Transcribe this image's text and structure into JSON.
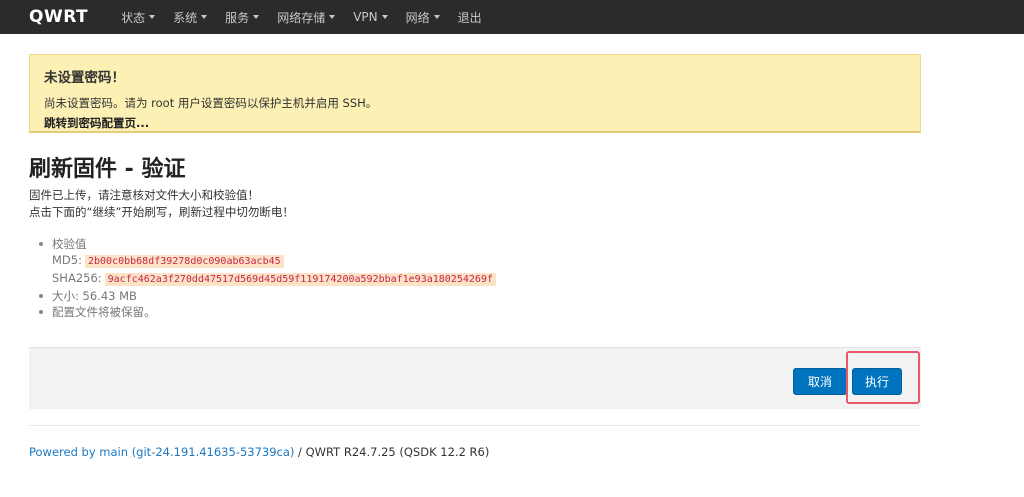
{
  "navbar": {
    "brand": "QWRT",
    "items": [
      {
        "label": "状态"
      },
      {
        "label": "系统"
      },
      {
        "label": "服务"
      },
      {
        "label": "网络存储"
      },
      {
        "label": "VPN"
      },
      {
        "label": "网络"
      },
      {
        "label": "退出"
      }
    ]
  },
  "alert": {
    "title": "未设置密码！",
    "text": "尚未设置密码。请为 root 用户设置密码以保护主机并启用 SSH。",
    "link": "跳转到密码配置页..."
  },
  "page": {
    "title": "刷新固件 - 验证",
    "desc1": "固件已上传，请注意核对文件大小和校验值！",
    "desc2": "点击下面的“继续”开始刷写，刷新过程中切勿断电！"
  },
  "info": {
    "checksum_label": "校验值",
    "md5_label": "MD5:",
    "md5": "2b00c0bb68df39278d0c090ab63acb45",
    "sha256_label": "SHA256:",
    "sha256": "9acfc462a3f270dd47517d569d45d59f119174200a592bbaf1e93a180254269f",
    "size": "大小: 56.43 MB",
    "config": "配置文件将被保留。"
  },
  "actions": {
    "cancel": "取消",
    "execute": "执行",
    "highlight_color": "#e8576a",
    "button_color": "#0073bf"
  },
  "footer": {
    "powered_by": "Powered by main (git-24.191.41635-53739ca)",
    "version": " / QWRT R24.7.25 (QSDK 12.2 R6)"
  }
}
